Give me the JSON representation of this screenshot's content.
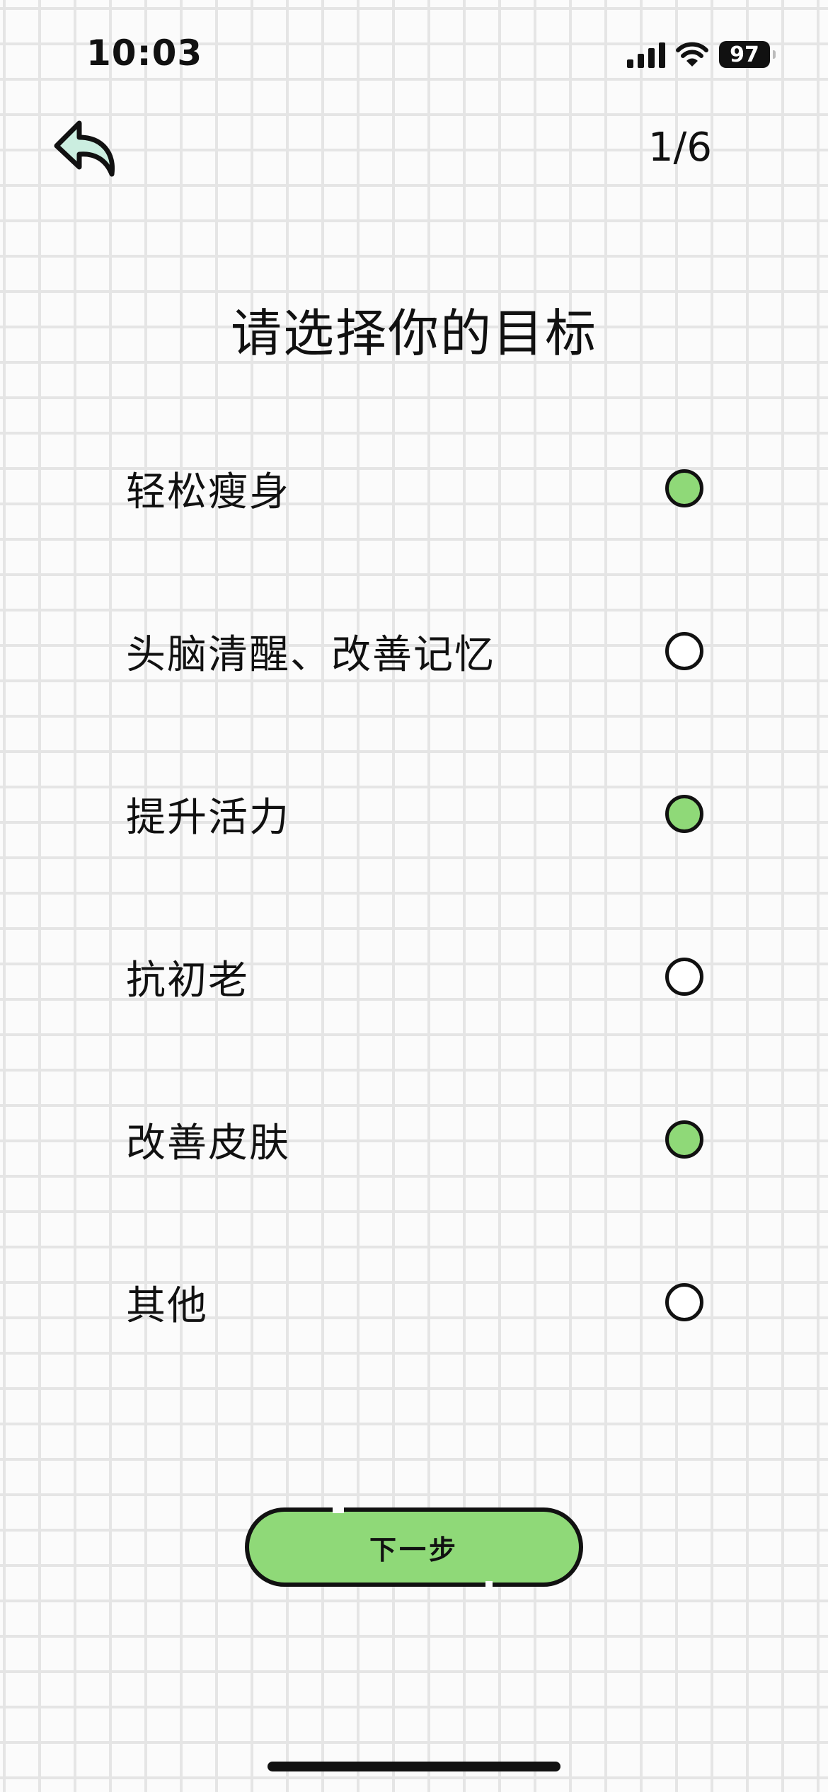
{
  "status_bar": {
    "time": "10:03",
    "battery": "97",
    "icons": [
      "cellular-signal-icon",
      "wifi-icon",
      "battery-icon"
    ]
  },
  "header": {
    "back_icon": "back-arrow-icon",
    "step": "1/6"
  },
  "title": "请选择你的目标",
  "options": [
    {
      "label": "轻松瘦身",
      "selected": true
    },
    {
      "label": "头脑清醒、改善记忆",
      "selected": false
    },
    {
      "label": "提升活力",
      "selected": true
    },
    {
      "label": "抗初老",
      "selected": false
    },
    {
      "label": "改善皮肤",
      "selected": true
    },
    {
      "label": "其他",
      "selected": false
    }
  ],
  "next_button": {
    "label": "下一步"
  },
  "colors": {
    "accent": "#8fd978",
    "outline": "#111111",
    "background": "#fbfbfb",
    "grid": "#e5e5e5"
  }
}
